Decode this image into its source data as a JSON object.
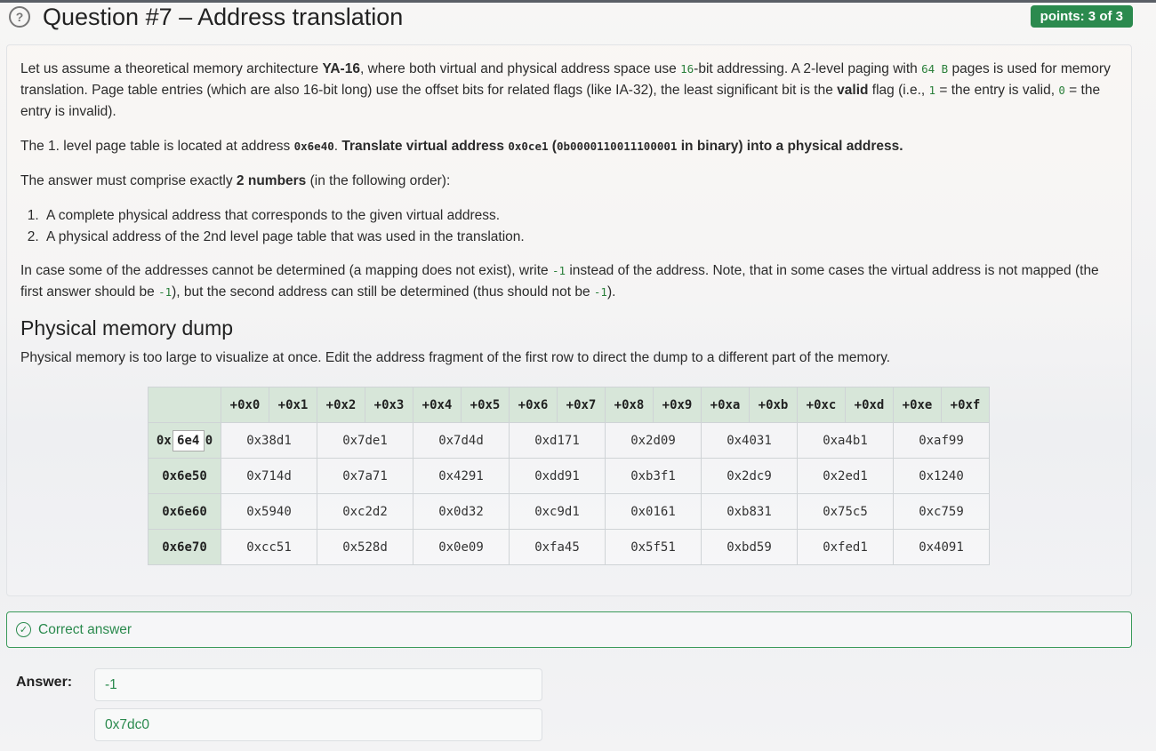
{
  "question": {
    "title": "Question #7 – Address translation",
    "points": "points: 3 of 3"
  },
  "intro": {
    "t1": "Let us assume a theoretical memory architecture ",
    "arch": "YA-16",
    "t2": ", where both virtual and physical address space use ",
    "bits": "16",
    "t3": "-bit addressing. A 2-level paging with ",
    "page": "64 B",
    "t4": " pages is used for memory translation. Page table entries (which are also 16-bit long) use the offset bits for related flags (like IA-32), the least significant bit is the ",
    "valid": "valid",
    "t5": " flag (i.e., ",
    "one": "1",
    "t6": " = the entry is valid, ",
    "zero": "0",
    "t7": " = the entry is invalid)."
  },
  "task": {
    "t1": "The 1. level page table is located at address ",
    "pt_addr": "0x6e40",
    "t2": ". ",
    "b1": "Translate virtual address ",
    "vaddr": "0x0ce1",
    "b2": " (",
    "vbin": "0b0000110011100001",
    "b3": " in binary) into a physical address."
  },
  "answer_req": {
    "t1": "The answer must comprise exactly ",
    "b": "2 numbers",
    "t2": " (in the following order):",
    "items": [
      "A complete physical address that corresponds to the given virtual address.",
      "A physical address of the 2nd level page table that was used in the translation."
    ]
  },
  "note": {
    "t1": "In case some of the addresses cannot be determined (a mapping does not exist), write ",
    "neg": "-1",
    "t2": " instead of the address. Note, that in some cases the virtual address is not mapped (the first answer should be ",
    "t3": "), but the second address can still be determined (thus should not be ",
    "t4": ")."
  },
  "dump": {
    "heading": "Physical memory dump",
    "desc": "Physical memory is too large to visualize at once. Edit the address fragment of the first row to direct the dump to a different part of the memory.",
    "col_headers": [
      "+0x0",
      "+0x1",
      "+0x2",
      "+0x3",
      "+0x4",
      "+0x5",
      "+0x6",
      "+0x7",
      "+0x8",
      "+0x9",
      "+0xa",
      "+0xb",
      "+0xc",
      "+0xd",
      "+0xe",
      "+0xf"
    ],
    "first_row": {
      "prefix": "0x",
      "input": "6e4",
      "suffix": "0"
    },
    "rows": [
      {
        "addr": "0x6e40",
        "cells": [
          "0x38d1",
          "0x7de1",
          "0x7d4d",
          "0xd171",
          "0x2d09",
          "0x4031",
          "0xa4b1",
          "0xaf99"
        ]
      },
      {
        "addr": "0x6e50",
        "cells": [
          "0x714d",
          "0x7a71",
          "0x4291",
          "0xdd91",
          "0xb3f1",
          "0x2dc9",
          "0x2ed1",
          "0x1240"
        ]
      },
      {
        "addr": "0x6e60",
        "cells": [
          "0x5940",
          "0xc2d2",
          "0x0d32",
          "0xc9d1",
          "0x0161",
          "0xb831",
          "0x75c5",
          "0xc759"
        ]
      },
      {
        "addr": "0x6e70",
        "cells": [
          "0xcc51",
          "0x528d",
          "0x0e09",
          "0xfa45",
          "0x5f51",
          "0xbd59",
          "0xfed1",
          "0x4091"
        ]
      }
    ]
  },
  "result": {
    "status": "Correct answer",
    "label": "Answer:",
    "answers": [
      "-1",
      "0x7dc0"
    ]
  }
}
